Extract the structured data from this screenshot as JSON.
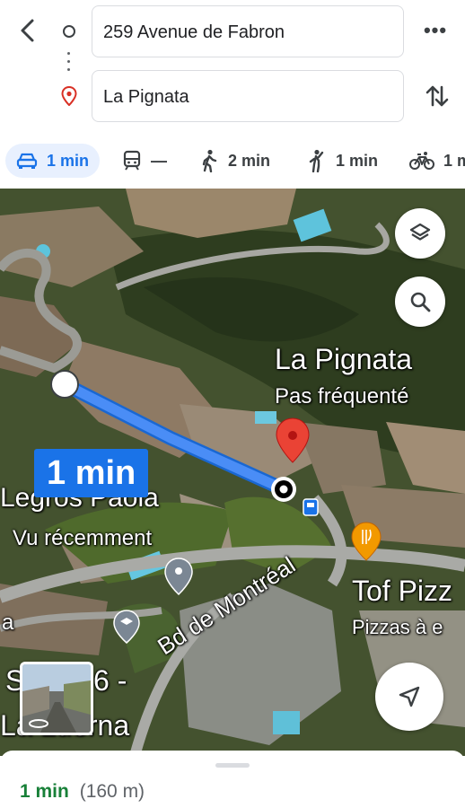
{
  "header": {
    "origin_value": "259 Avenue de Fabron",
    "destination_value": "La Pignata",
    "more_label": "•••"
  },
  "modes": [
    {
      "name": "drive",
      "label": "1 min",
      "icon": "car-icon",
      "active": true
    },
    {
      "name": "transit",
      "label": "—",
      "icon": "train-icon",
      "active": false
    },
    {
      "name": "walk",
      "label": "2 min",
      "icon": "walk-icon",
      "active": false
    },
    {
      "name": "ride",
      "label": "1 min",
      "icon": "rideshare-icon",
      "active": false
    },
    {
      "name": "bike",
      "label": "1 m",
      "icon": "bike-icon",
      "active": false
    }
  ],
  "map": {
    "destination_title": "La Pignata",
    "destination_subtitle": "Pas fréquenté",
    "route_duration": "1 min",
    "place_1_title": "Legros Paola",
    "place_1_subtitle": "Vu récemment",
    "place_2_title": "Tof Pizz",
    "place_2_subtitle": "Pizzas à e",
    "road_name": "Bd de Montréal",
    "label_s": "S",
    "label_6": "6 -",
    "label_lalu": "La Luerna",
    "label_a": "a"
  },
  "sheet": {
    "duration": "1 min",
    "distance": "(160 m)"
  },
  "colors": {
    "accent": "#1a73e8",
    "route": "#4285f4",
    "destination_pin": "#ea4335",
    "duration_green": "#188038"
  }
}
